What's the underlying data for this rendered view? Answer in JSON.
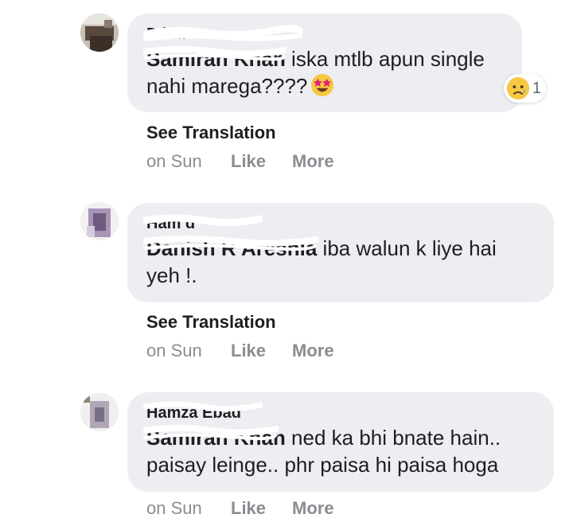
{
  "comments": [
    {
      "author": "D                         hia",
      "mention": "Samirah Khan",
      "text": " iska mtlb apun single nahi marega????",
      "emoji": "star-struck",
      "reaction": {
        "emoji": "sad-tear",
        "count": "1"
      },
      "see_translation": "See Translation",
      "time": "on Sun",
      "like": "Like",
      "more": "More"
    },
    {
      "author": "Ham          d",
      "mention": "Danish R Areshia",
      "text": " iba walun k liye hai yeh !.",
      "see_translation": "See Translation",
      "time": "on Sun",
      "like": "Like",
      "more": "More"
    },
    {
      "author": "Hamza Ebad",
      "mention": "Samirah Khan",
      "text": " ned ka bhi bnate hain.. paisay leinge.. phr paisa hi paisa hoga",
      "time": "on Sun",
      "like": "Like",
      "more": "More"
    }
  ]
}
